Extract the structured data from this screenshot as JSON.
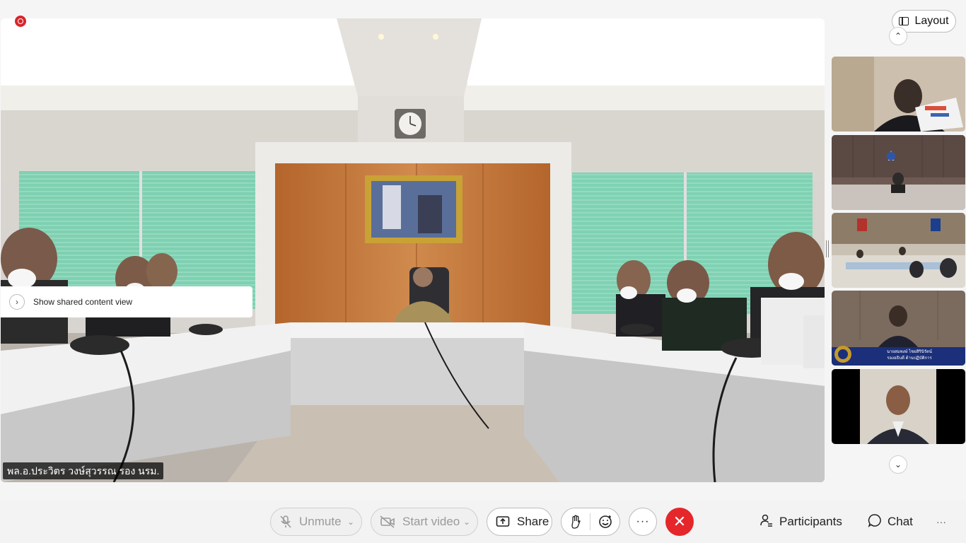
{
  "main": {
    "speaker_name": "พล.อ.ประวิตร วงษ์สุวรรณ รอง นรม.",
    "shared_content_label": "Show shared content view"
  },
  "rail": {
    "layout_label": "Layout",
    "thumbnails": [
      {
        "scene": "person-reading-document"
      },
      {
        "scene": "meeting-room-logo"
      },
      {
        "scene": "conference-room-wide"
      },
      {
        "scene": "official-with-nameplate",
        "caption_line1": "นายสมพงษ์ ไชยสิรินิรัตน์",
        "caption_line2": "รองอธิบดี ด้านปฏิบัติการ"
      },
      {
        "scene": "man-in-suit"
      }
    ]
  },
  "toolbar": {
    "unmute_label": "Unmute",
    "start_video_label": "Start video",
    "share_label": "Share",
    "participants_label": "Participants",
    "chat_label": "Chat",
    "more_label": "···",
    "end_color": "#e5262a"
  },
  "colors": {
    "record": "#d7262b",
    "accent_end": "#e5262a"
  }
}
